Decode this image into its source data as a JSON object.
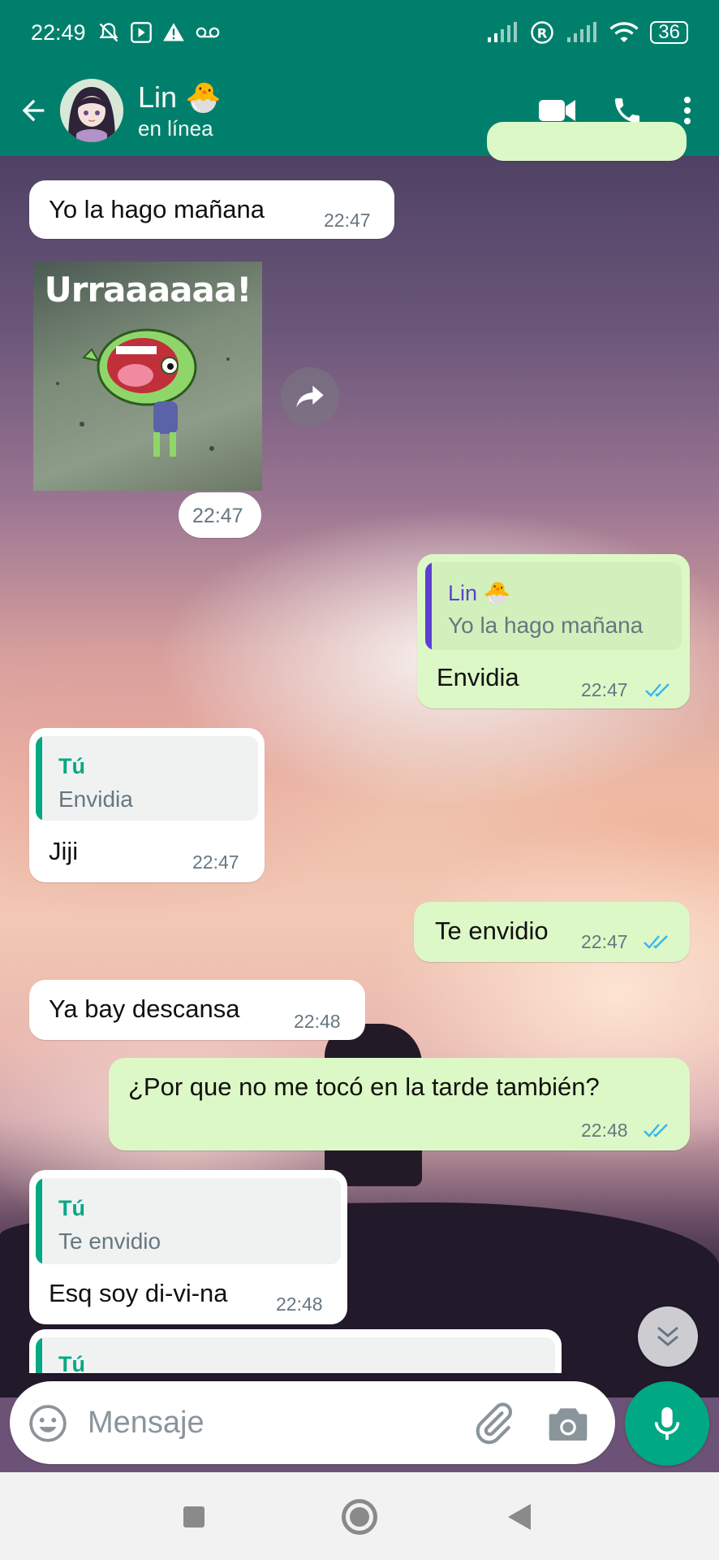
{
  "status_bar": {
    "time": "22:49",
    "battery": "36"
  },
  "header": {
    "contact_name": "Lin 🐣",
    "contact_status": "en línea"
  },
  "messages": [
    {
      "direction": "in",
      "text": "Yo la hago mañana",
      "time": "22:47"
    },
    {
      "direction": "in",
      "type": "sticker",
      "sticker_text": "Urraaaaaa!",
      "time": "22:47"
    },
    {
      "direction": "out",
      "quote_author": "Lin 🐣",
      "quote_text": "Yo la hago mañana",
      "text": "Envidia",
      "time": "22:47",
      "read": true
    },
    {
      "direction": "in",
      "quote_author": "Tú",
      "quote_text": "Envidia",
      "text": "Jiji",
      "time": "22:47"
    },
    {
      "direction": "out",
      "text": "Te envidio",
      "time": "22:47",
      "read": true
    },
    {
      "direction": "in",
      "text": "Ya bay descansa",
      "time": "22:48"
    },
    {
      "direction": "out",
      "text": "¿Por que no me tocó en la tarde también?",
      "time": "22:48",
      "read": true
    },
    {
      "direction": "in",
      "quote_author": "Tú",
      "quote_text": "Te envidio",
      "text": "Esq soy di-vi-na",
      "time": "22:48"
    },
    {
      "direction": "in",
      "quote_author": "Tú",
      "partial": true
    }
  ],
  "input": {
    "placeholder": "Mensaje"
  },
  "colors": {
    "header": "#00806c",
    "outgoing_bubble": "#dcf8c6",
    "incoming_bubble": "#ffffff",
    "read_tick": "#34b7f1",
    "mic_button": "#00a884"
  }
}
